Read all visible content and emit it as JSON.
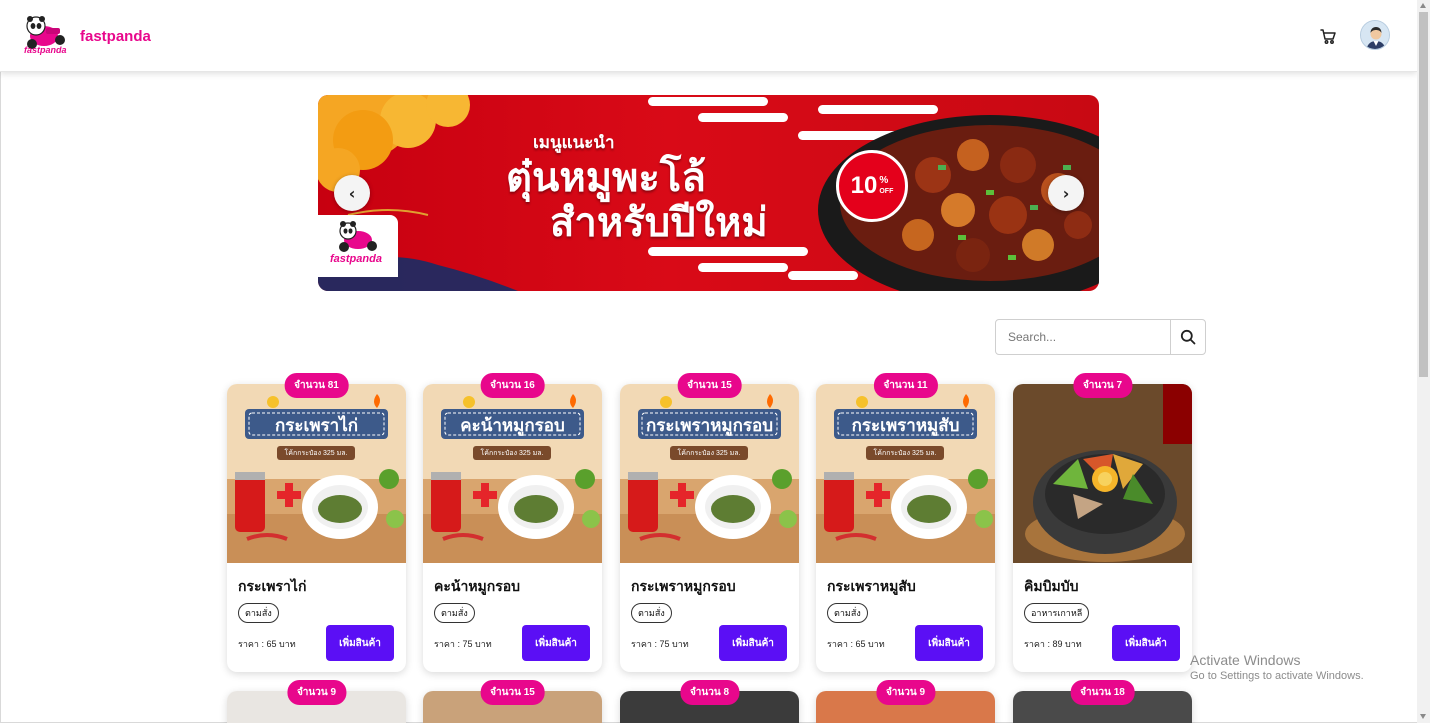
{
  "brand": {
    "name": "fastpanda",
    "color": "#e8078c",
    "logo_text": "fastpanda"
  },
  "header": {
    "cart_icon": "cart-icon",
    "avatar": "user-avatar"
  },
  "banner": {
    "subtitle": "เมนูแนะนำ",
    "title_line1": "ตุ๋นหมูพะโล้",
    "title_line2": "สำหรับปีใหม่",
    "discount_value": "10",
    "discount_unit": "%",
    "discount_off": "OFF",
    "logo_text": "fastpanda",
    "prev_label": "‹",
    "next_label": "›"
  },
  "search": {
    "placeholder": "Search..."
  },
  "products": [
    {
      "qty": "จำนวน 81",
      "name": "กระเพราไก่",
      "category": "ตามสั่ง",
      "price": "ราคา : 65 บาท",
      "button": "เพิ่มสินค้า",
      "banner_text": "กระเพราไก่",
      "can_text": "โค้กกระป๋อง 325 มล."
    },
    {
      "qty": "จำนวน 16",
      "name": "คะน้าหมูกรอบ",
      "category": "ตามสั่ง",
      "price": "ราคา : 75 บาท",
      "button": "เพิ่มสินค้า",
      "banner_text": "คะน้าหมูกรอบ",
      "can_text": "โค้กกระป๋อง 325 มล."
    },
    {
      "qty": "จำนวน 15",
      "name": "กระเพราหมูกรอบ",
      "category": "ตามสั่ง",
      "price": "ราคา : 75 บาท",
      "button": "เพิ่มสินค้า",
      "banner_text": "กระเพราหมูกรอบ",
      "can_text": "โค้กกระป๋อง 325 มล."
    },
    {
      "qty": "จำนวน 11",
      "name": "กระเพราหมูสับ",
      "category": "ตามสั่ง",
      "price": "ราคา : 65 บาท",
      "button": "เพิ่มสินค้า",
      "banner_text": "กระเพราหมูสับ",
      "can_text": "โค้กกระป๋อง 325 มล."
    },
    {
      "qty": "จำนวน 7",
      "name": "คิมบิมบับ",
      "category": "อาหารเกาหลี",
      "price": "ราคา : 89 บาท",
      "button": "เพิ่มสินค้า"
    }
  ],
  "products_row2": [
    {
      "qty": "จำนวน 9"
    },
    {
      "qty": "จำนวน 15"
    },
    {
      "qty": "จำนวน 8"
    },
    {
      "qty": "จำนวน 9"
    },
    {
      "qty": "จำนวน 18"
    }
  ],
  "watermark": {
    "title": "Activate Windows",
    "subtitle": "Go to Settings to activate Windows."
  },
  "colors": {
    "accent": "#e8078c",
    "button": "#5b0ff5",
    "banner_red": "#d90a17"
  }
}
